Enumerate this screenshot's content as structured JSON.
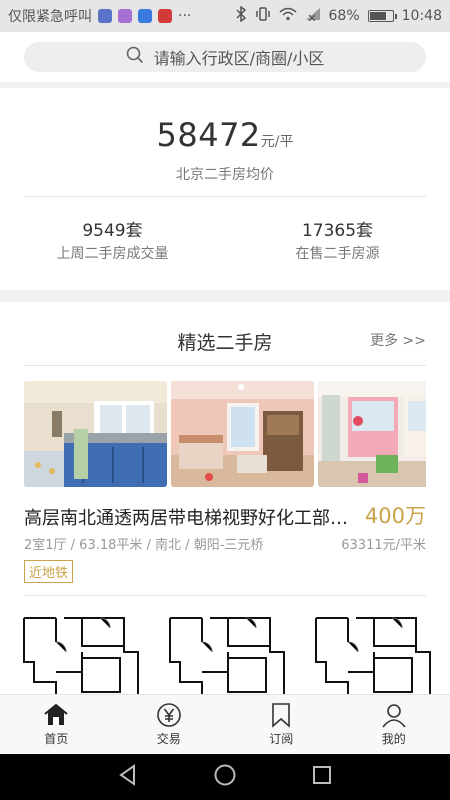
{
  "status_bar": {
    "left_text": "仅限紧急呼叫",
    "more": "···",
    "battery": "68%",
    "battery_level": 0.68,
    "time": "10:48"
  },
  "search": {
    "placeholder": "请输入行政区/商圈/小区"
  },
  "stats": {
    "avg_price": "58472",
    "avg_unit": "元/平",
    "avg_label": "北京二手房均价",
    "weekly_deals_value": "9549套",
    "weekly_deals_label": "上周二手房成交量",
    "on_sale_value": "17365套",
    "on_sale_label": "在售二手房源"
  },
  "featured": {
    "title": "精选二手房",
    "more": "更多 >>",
    "listing": {
      "title": "高层南北通透两居带电梯视野好化工部…",
      "price": "400万",
      "meta": "2室1厅 / 63.18平米 / 南北 / 朝阳-三元桥",
      "unit_price": "63311元/平米",
      "tag": "近地铁"
    }
  },
  "tabs": [
    {
      "label": "首页",
      "icon": "home-icon",
      "active": true
    },
    {
      "label": "交易",
      "icon": "yen-icon",
      "active": false
    },
    {
      "label": "订阅",
      "icon": "bookmark-icon",
      "active": false
    },
    {
      "label": "我的",
      "icon": "user-icon",
      "active": false
    }
  ],
  "colors": {
    "accent": "#c9a24a",
    "text": "#333333"
  }
}
